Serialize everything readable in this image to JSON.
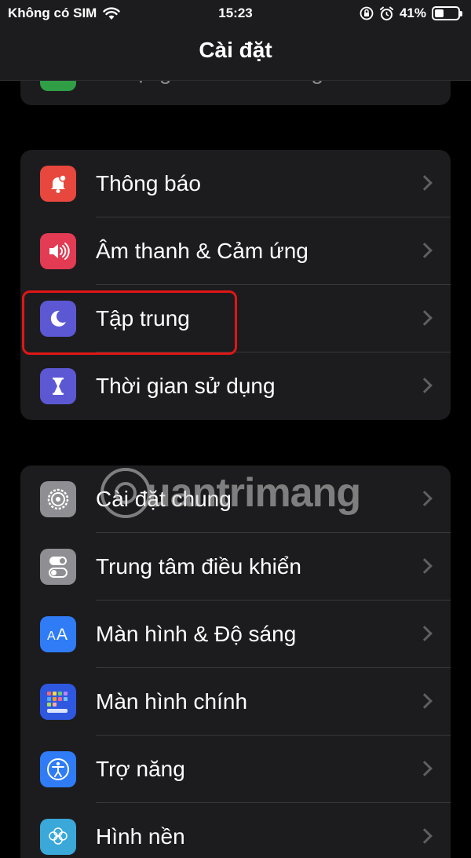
{
  "status": {
    "carrier": "Không có SIM",
    "time": "15:23",
    "battery": "41%",
    "battery_level": 0.41
  },
  "nav": {
    "title": "Cài đặt"
  },
  "top_group_partial": {
    "label": "Di động",
    "value": "Không có SIM"
  },
  "group1": [
    {
      "label": "Thông báo",
      "icon": "bell-icon",
      "color": "#e8473d"
    },
    {
      "label": "Âm thanh & Cảm ứng",
      "icon": "speaker-icon",
      "color": "#e23b53"
    },
    {
      "label": "Tập trung",
      "icon": "moon-icon",
      "color": "#5c58d4"
    },
    {
      "label": "Thời gian sử dụng",
      "icon": "hourglass-icon",
      "color": "#5c58d4"
    }
  ],
  "group2": [
    {
      "label": "Cài đặt chung",
      "icon": "gear-icon",
      "color": "#8e8e93"
    },
    {
      "label": "Trung tâm điều khiển",
      "icon": "toggle-icon",
      "color": "#8e8e93"
    },
    {
      "label": "Màn hình & Độ sáng",
      "icon": "text-size-icon",
      "color": "#2f7cf6"
    },
    {
      "label": "Màn hình chính",
      "icon": "home-grid-icon",
      "color": "#2f58e0"
    },
    {
      "label": "Trợ năng",
      "icon": "accessibility-icon",
      "color": "#2f7cf6"
    },
    {
      "label": "Hình nền",
      "icon": "flower-icon",
      "color": "#3aa8d8"
    }
  ],
  "watermark": "uantrimang"
}
